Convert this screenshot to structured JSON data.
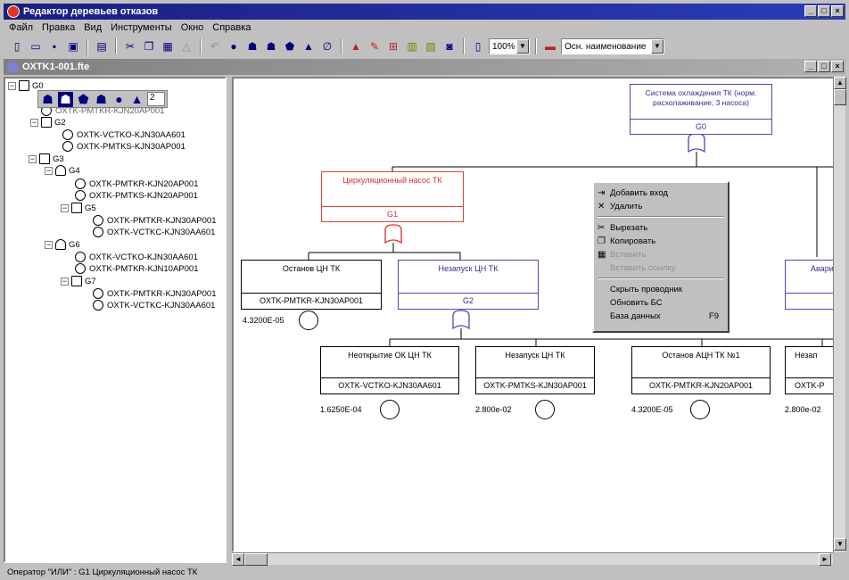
{
  "window": {
    "title": "Редактор деревьев отказов",
    "min": "_",
    "max": "□",
    "close": "×"
  },
  "menu": [
    "Файл",
    "Правка",
    "Вид",
    "Инструменты",
    "Окно",
    "Справка"
  ],
  "toolbar": {
    "zoom": "100%",
    "name_mode": "Осн. наименование"
  },
  "doc": {
    "title": "OXTK1-001.fte"
  },
  "palette": {
    "value": "2"
  },
  "tree": {
    "root": "G0",
    "hidden_item": "OXTK-PMTKR-KJN20AP001",
    "g2": "G2",
    "g2_items": [
      "OXTK-VCTKO-KJN30AA601",
      "OXTK-PMTKS-KJN30AP001"
    ],
    "g3": "G3",
    "g4": "G4",
    "g4_items": [
      "OXTK-PMTKR-KJN20AP001",
      "OXTK-PMTKS-KJN20AP001"
    ],
    "g5": "G5",
    "g5_items": [
      "OXTK-PMTKR-KJN30AP001",
      "OXTK-VCTKC-KJN30AA601"
    ],
    "g6": "G6",
    "g6_items": [
      "OXTK-VCTKO-KJN30AA601",
      "OXTK-PMTKR-KJN10AP001"
    ],
    "g7": "G7",
    "g7_items": [
      "OXTK-PMTKR-KJN30AP001",
      "OXTK-VCTKC-KJN30AA601"
    ]
  },
  "diagram": {
    "top": {
      "title": "Система охлаждения ТК (норм. расхолаживание, 3 насоса)",
      "code": "G0"
    },
    "g1": {
      "title": "Циркуляционный насос ТК",
      "code": "G1"
    },
    "stop": {
      "title": "Останов ЦН ТК",
      "code": "OXTK-PMTKR-KJN30AP001",
      "prob": "4.3200E-05"
    },
    "nostart": {
      "title": "Незапуск ЦН ТК",
      "code": "G2"
    },
    "right_partial": {
      "title": "Авари"
    },
    "leaves": [
      {
        "title": "Неоткрытие ОК ЦН ТК",
        "code": "OXTK-VCTKO-KJN30AA601",
        "prob": "1.6250E-04"
      },
      {
        "title": "Незапуск ЦН ТК",
        "code": "OXTK-PMTKS-KJN30AP001",
        "prob": "2.800e-02"
      },
      {
        "title": "Останов АЦН ТК №1",
        "code": "OXTK-PMTKR-KJN20AP001",
        "prob": "4.3200E-05"
      },
      {
        "title": "Незап",
        "code": "OXTK-P",
        "prob": "2.800e-02"
      }
    ]
  },
  "context_menu": {
    "add_input": "Добавить вход",
    "delete": "Удалить",
    "cut": "Вырезать",
    "copy": "Копировать",
    "paste": "Вставить",
    "paste_special": "Вставить ссылку",
    "hide_wires": "Скрыть проводник",
    "refresh_db": "Обновить БС",
    "database": "База данных",
    "database_shortcut": "F9"
  },
  "status": "Оператор \"ИЛИ\" : G1  Циркуляционный насос ТК"
}
